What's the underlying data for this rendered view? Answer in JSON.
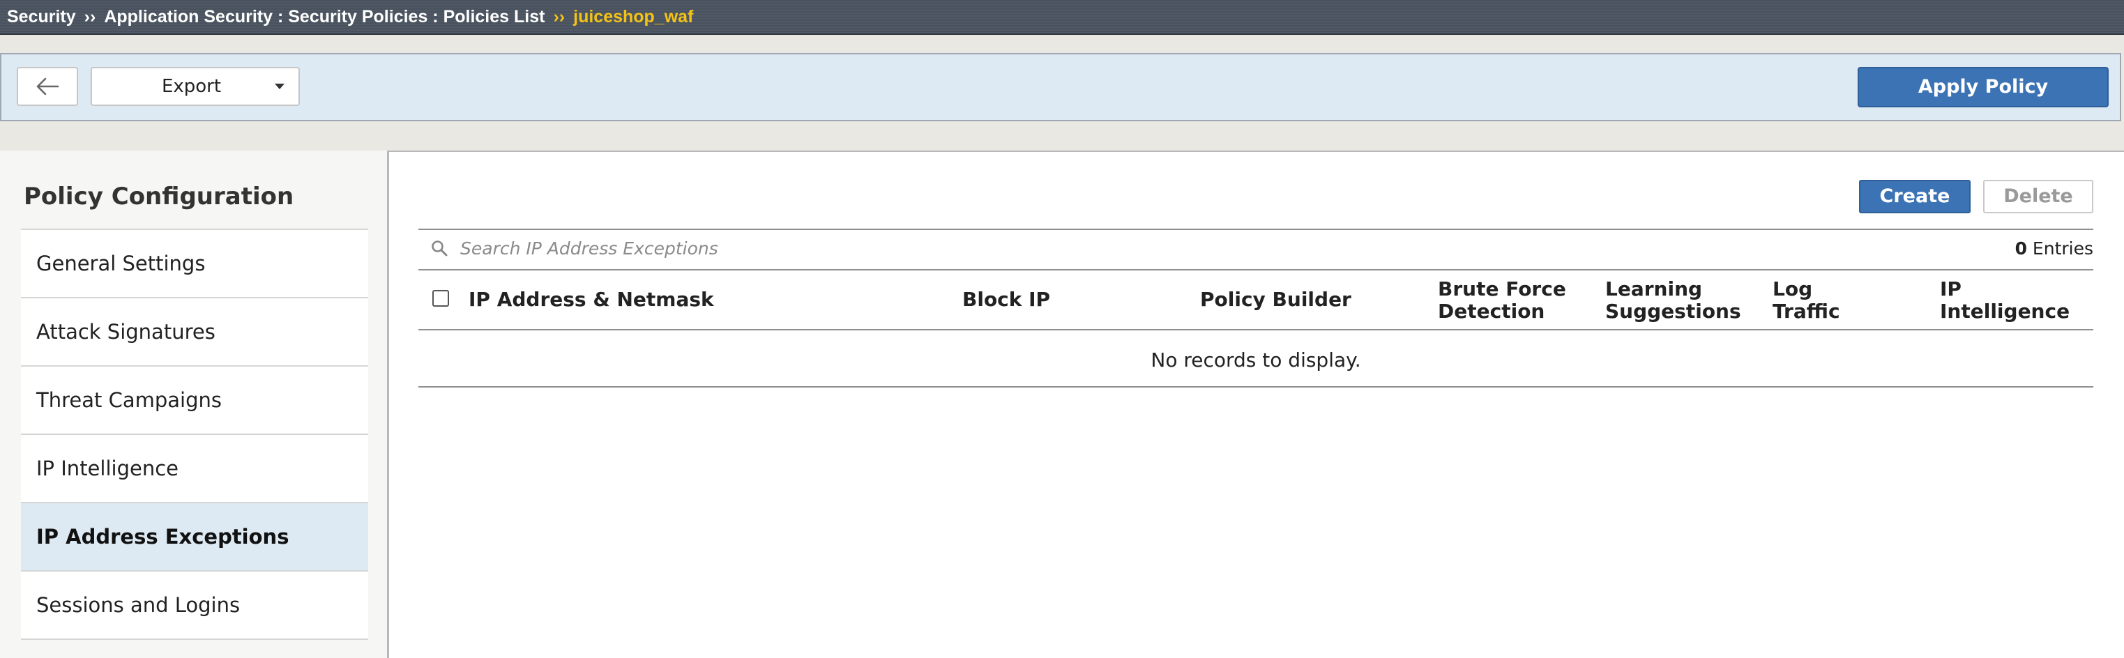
{
  "breadcrumb": {
    "items": [
      "Security",
      "Application Security : Security Policies : Policies List"
    ],
    "separator": "››",
    "current": "juiceshop_waf"
  },
  "toolbar": {
    "back_icon": "arrow-left-icon",
    "export_label": "Export",
    "apply_label": "Apply Policy"
  },
  "sidebar": {
    "heading": "Policy Configuration",
    "items": [
      {
        "label": "General Settings"
      },
      {
        "label": "Attack Signatures"
      },
      {
        "label": "Threat Campaigns"
      },
      {
        "label": "IP Intelligence"
      },
      {
        "label": "IP Address Exceptions",
        "active": true
      },
      {
        "label": "Sessions and Logins"
      }
    ]
  },
  "main": {
    "create_label": "Create",
    "delete_label": "Delete",
    "search_placeholder": "Search IP Address Exceptions",
    "entries_count": "0",
    "entries_label": "Entries",
    "columns": [
      {
        "line1": "IP Address & Netmask",
        "line2": ""
      },
      {
        "line1": "Block IP",
        "line2": ""
      },
      {
        "line1": "Policy Builder",
        "line2": ""
      },
      {
        "line1": "Brute Force",
        "line2": "Detection"
      },
      {
        "line1": "Learning",
        "line2": "Suggestions"
      },
      {
        "line1": "Log",
        "line2": "Traffic"
      },
      {
        "line1": "IP",
        "line2": "Intelligence"
      }
    ],
    "empty_text": "No records to display."
  },
  "colors": {
    "primary_button": "#3c73b4",
    "breadcrumb_highlight": "#f3c318",
    "breadcrumb_bg": "#4a5460",
    "toolbar_bg": "#dde9f3",
    "active_nav_bg": "#dde9f3"
  }
}
